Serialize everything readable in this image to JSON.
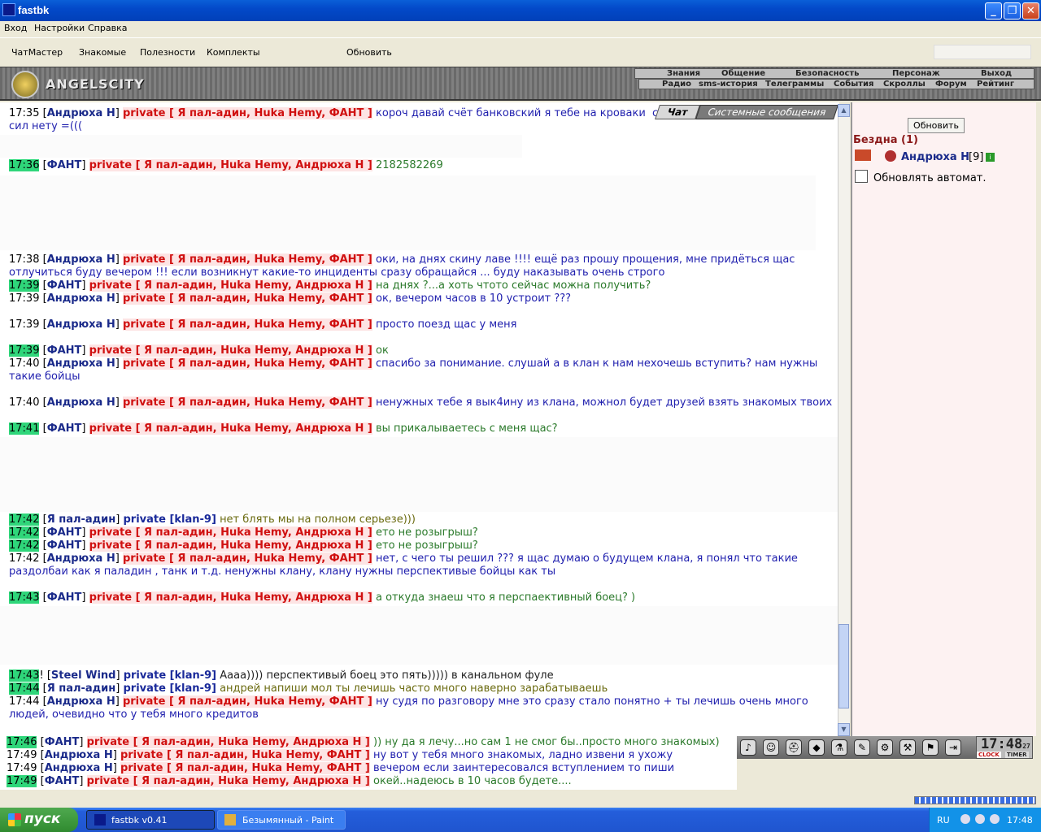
{
  "window": {
    "title": "fastbk",
    "min": "_",
    "max": "❐",
    "close": "✕"
  },
  "menu": [
    "Вход",
    "Настройки",
    "Справка"
  ],
  "toolbar": [
    "ЧатМастер",
    "Знакомые",
    "Полезности",
    "Комплекты",
    "Обновить"
  ],
  "banner": {
    "logo_text": "ANGELSCITY"
  },
  "nav_top": [
    "Знания",
    "Общение",
    "Безопасность",
    "Персонаж",
    "Выход"
  ],
  "nav_bottom": [
    "Радио",
    "sms-история",
    "Телеграммы",
    "События",
    "Скроллы",
    "Форум",
    "Рейтинг"
  ],
  "chat_tabs": {
    "chat": "Чат",
    "system": "Системные сообщения"
  },
  "messages": [
    {
      "time": "17:35",
      "hl": false,
      "nick": "Андрюха Н",
      "private": "private [ Я пал-адин, Huka Hemy, ФАНТ ]",
      "text": "короч давай счёт банковский я тебе на кроваки  сам кровавить, а то у меня уже сил нету =(((",
      "color": "blue"
    },
    {
      "time": "17:36",
      "hl": true,
      "nick": "ФАНТ",
      "private": "private [ Я пал-адин, Huka Hemy, Андрюха Н ]",
      "text": "2182582269",
      "color": "green"
    },
    {
      "time": "17:38",
      "hl": false,
      "nick": "Андрюха Н",
      "private": "private [ Я пал-адин, Huka Hemy, ФАНТ ]",
      "text": "оки, на днях скину лаве !!!! ещё раз прошу прощения, мне придёться щас отлучиться буду вечером !!! если возникнут какие-то инциденты сразу обращайся ... буду наказывать очень строго",
      "color": "blue"
    },
    {
      "time": "17:39",
      "hl": true,
      "nick": "ФАНТ",
      "private": "private [ Я пал-адин, Huka Hemy, Андрюха Н ]",
      "text": "на днях ?...а хоть чтото сейчас можна получить?",
      "color": "green"
    },
    {
      "time": "17:39",
      "hl": false,
      "nick": "Андрюха Н",
      "private": "private [ Я пал-адин, Huka Hemy, ФАНТ ]",
      "text": "ок, вечером часов в 10 устроит ???",
      "color": "blue"
    },
    {
      "time": "17:39",
      "hl": false,
      "nick": "Андрюха Н",
      "private": "private [ Я пал-адин, Huka Hemy, ФАНТ ]",
      "text": "просто поезд щас у меня",
      "color": "blue"
    },
    {
      "time": "17:39",
      "hl": true,
      "nick": "ФАНТ",
      "private": "private [ Я пал-адин, Huka Hemy, Андрюха Н ]",
      "text": "ок",
      "color": "green"
    },
    {
      "time": "17:40",
      "hl": false,
      "nick": "Андрюха Н",
      "private": "private [ Я пал-адин, Huka Hemy, ФАНТ ]",
      "text": "спасибо за понимание. слушай а в клан к нам нехочешь вступить? нам нужны такие бойцы",
      "color": "blue"
    },
    {
      "time": "17:40",
      "hl": false,
      "nick": "Андрюха Н",
      "private": "private [ Я пал-адин, Huka Hemy, ФАНТ ]",
      "text": "ненужных тебе я вык4ину из клана, можнол будет друзей взять знакомых твоих",
      "color": "blue"
    },
    {
      "time": "17:41",
      "hl": true,
      "nick": "ФАНТ",
      "private": "private [ Я пал-адин, Huka Hemy, Андрюха Н ]",
      "text": "вы прикалываетесь с меня щас?",
      "color": "green"
    },
    {
      "time": "17:42",
      "hl": true,
      "nick": "Я пал-адин",
      "private": "private [klan-9]",
      "text": "нет блять мы на полном серьезе)))",
      "color": "olive",
      "klan": true
    },
    {
      "time": "17:42",
      "hl": true,
      "nick": "ФАНТ",
      "private": "private [ Я пал-адин, Huka Hemy, Андрюха Н ]",
      "text": "ето не розыгрыш?",
      "color": "green"
    },
    {
      "time": "17:42",
      "hl": true,
      "nick": "ФАНТ",
      "private": "private [ Я пал-адин, Huka Hemy, Андрюха Н ]",
      "text": "ето не розыгрыш?",
      "color": "green"
    },
    {
      "time": "17:42",
      "hl": false,
      "nick": "Андрюха Н",
      "private": "private [ Я пал-адин, Huka Hemy, ФАНТ ]",
      "text": "нет, с чего ты решил ??? я щас думаю о будущем клана, я понял что такие раздолбаи как я паладин , танк и т.д. ненужны клану, клану нужны перспективые бойцы как ты",
      "color": "blue"
    },
    {
      "time": "17:43",
      "hl": true,
      "nick": "ФАНТ",
      "private": "private [ Я пал-адин, Huka Hemy, Андрюха Н ]",
      "text": "а откуда знаеш что я перспаективный боец? )",
      "color": "green"
    },
    {
      "time": "17:43",
      "hl": true,
      "nick": "Steel Wind",
      "private": "private [klan-9]",
      "text": "Аааа)))) перспективый боец это пять))))) в канальном фуле",
      "color": "black",
      "klan": true,
      "bang": "!"
    },
    {
      "time": "17:44",
      "hl": true,
      "nick": "Я пал-адин",
      "private": "private [klan-9]",
      "text": "андрей напиши мол ты лечишь часто много наверно зарабатываешь",
      "color": "olive",
      "klan": true
    },
    {
      "time": "17:44",
      "hl": false,
      "nick": "Андрюха Н",
      "private": "private [ Я пал-адин, Huka Hemy, ФАНТ ]",
      "text": "ну судя по разговору мне это сразу стало понятно + ты лечишь очень много людей, очевидно что у тебя много кредитов",
      "color": "blue"
    }
  ],
  "bottom_messages": [
    {
      "time": "17:46",
      "hl": true,
      "nick": "ФАНТ",
      "private": "private [ Я пал-адин, Huka Hemy, Андрюха Н ]",
      "text": ")) ну да я лечу...но сам 1 не смог бы..просто много знакомых)",
      "color": "green"
    },
    {
      "time": "17:49",
      "hl": false,
      "nick": "Андрюха Н",
      "private": "private [ Я пал-адин, Huka Hemy, ФАНТ ]",
      "text": "ну вот у тебя много знакомых, ладно извени я ухожу",
      "color": "blue"
    },
    {
      "time": "17:49",
      "hl": false,
      "nick": "Андрюха Н",
      "private": "private [ Я пал-адин, Huka Hemy, ФАНТ ]",
      "text": "вечером если заинтересовался вступлением то пиши",
      "color": "blue"
    },
    {
      "time": "17:49",
      "hl": true,
      "nick": "ФАНТ",
      "private": "private [ Я пал-адин, Huka Hemy, Андрюха Н ]",
      "text": "окей..надеюсь в 10 часов будете....",
      "color": "green"
    }
  ],
  "right_panel": {
    "refresh": "Обновить",
    "room": "Бездна (1)",
    "user_name": "Андрюха Н",
    "user_level": "[9]",
    "user_info": "i",
    "auto_refresh": "Обновлять автомат."
  },
  "clock": {
    "time": "17:48",
    "seconds": "27",
    "clock_label": "CLOCK",
    "timer_label": "TIMER"
  },
  "taskbar": {
    "start": "пуск",
    "task1": "fastbk v0.41",
    "task2": "Безымянный - Paint",
    "lang": "RU",
    "time": "17:48"
  },
  "scroll": {
    "up": "▲",
    "down": "▼"
  },
  "icons": [
    "sound-icon",
    "smile-icon",
    "helmet-icon",
    "shield-icon",
    "potion-icon",
    "scroll-icon",
    "gear-icon",
    "tools-icon",
    "flag-icon",
    "exit-icon"
  ],
  "icon_glyphs": [
    "♪",
    "☺",
    "⛑",
    "◆",
    "⚗",
    "✎",
    "⚙",
    "⚒",
    "⚑",
    "⇥"
  ]
}
